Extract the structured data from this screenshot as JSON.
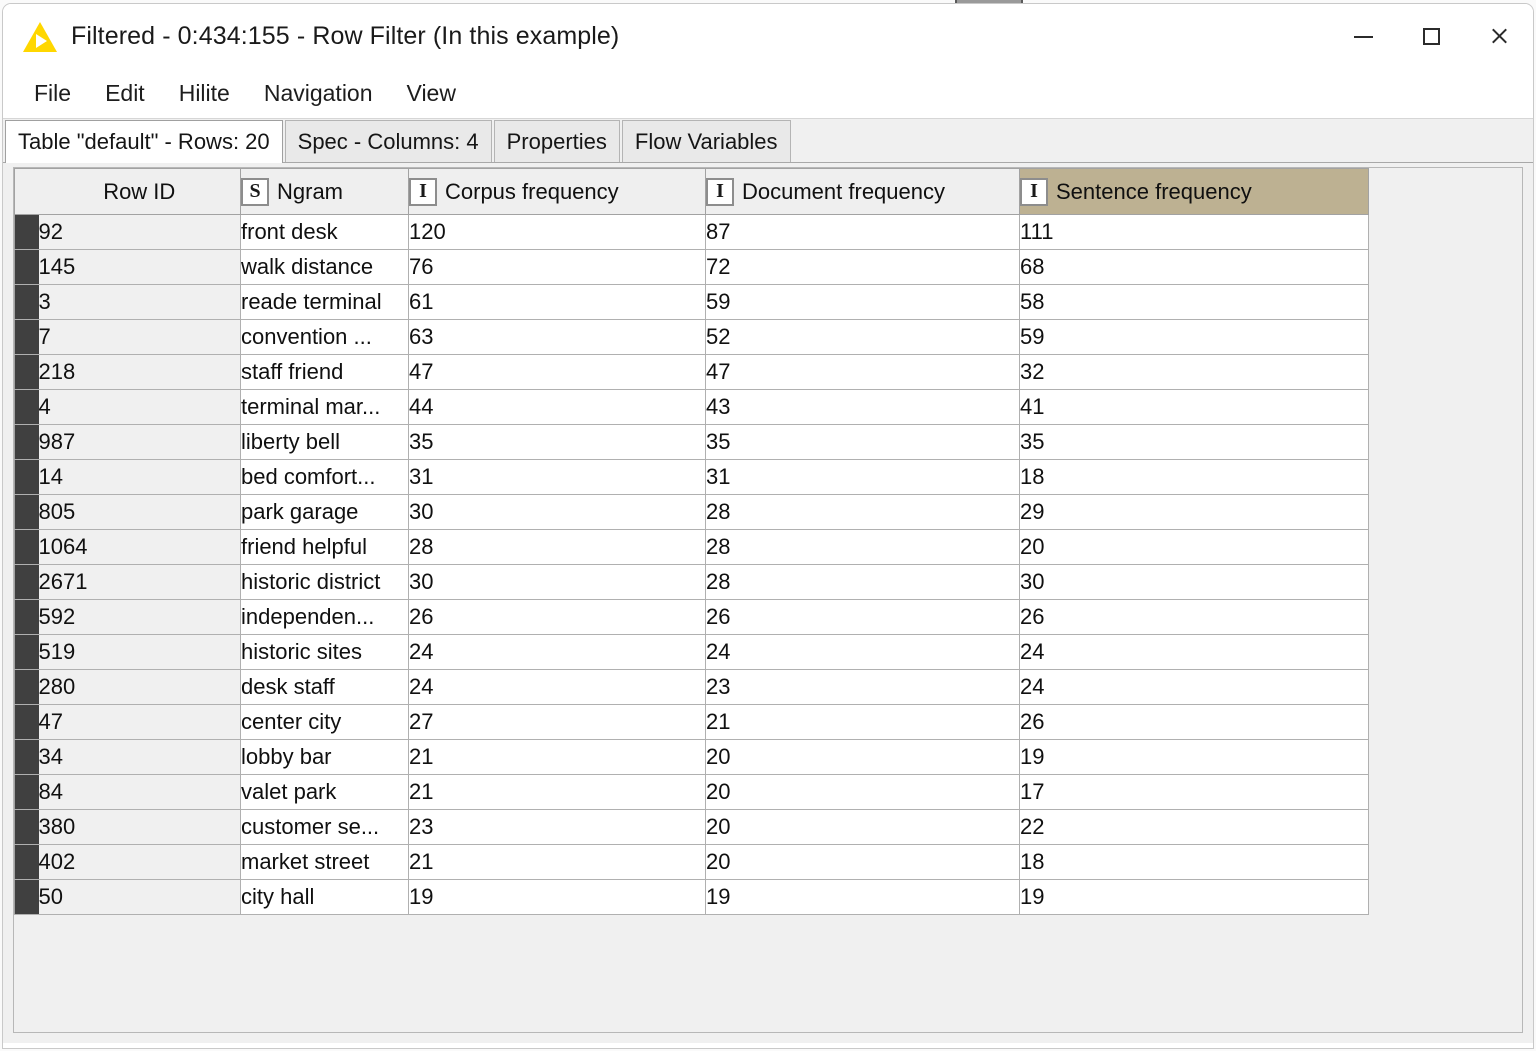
{
  "window": {
    "title": "Filtered - 0:434:155 - Row Filter (In this example)",
    "app_icon": "knime-triangle-icon",
    "controls": {
      "minimize": "minimize-icon",
      "maximize": "maximize-icon",
      "close": "close-icon"
    }
  },
  "menubar": {
    "items": [
      {
        "label": "File"
      },
      {
        "label": "Edit"
      },
      {
        "label": "Hilite"
      },
      {
        "label": "Navigation"
      },
      {
        "label": "View"
      }
    ]
  },
  "tabs": [
    {
      "label": "Table \"default\" - Rows: 20",
      "selected": true
    },
    {
      "label": "Spec - Columns: 4",
      "selected": false
    },
    {
      "label": "Properties",
      "selected": false
    },
    {
      "label": "Flow Variables",
      "selected": false
    }
  ],
  "colors": {
    "selected_column_header": "#bdb192",
    "row_swatch": "#404040",
    "accent_icon": "#ffd700"
  },
  "table": {
    "columns": [
      {
        "id": "rowid",
        "label": "Row ID",
        "type_icon": "",
        "selected": false
      },
      {
        "id": "ngram",
        "label": "Ngram",
        "type_icon": "S",
        "selected": false
      },
      {
        "id": "corpus",
        "label": "Corpus frequency",
        "type_icon": "I",
        "selected": false
      },
      {
        "id": "doc",
        "label": "Document frequency",
        "type_icon": "I",
        "selected": false
      },
      {
        "id": "sent",
        "label": "Sentence frequency",
        "type_icon": "I",
        "selected": true
      }
    ],
    "rows": [
      {
        "rowid": "92",
        "ngram": "front desk",
        "corpus": "120",
        "doc": "87",
        "sent": "111"
      },
      {
        "rowid": "145",
        "ngram": "walk distance",
        "corpus": "76",
        "doc": "72",
        "sent": "68"
      },
      {
        "rowid": "3",
        "ngram": "reade terminal",
        "corpus": "61",
        "doc": "59",
        "sent": "58"
      },
      {
        "rowid": "7",
        "ngram": "convention ...",
        "corpus": "63",
        "doc": "52",
        "sent": "59"
      },
      {
        "rowid": "218",
        "ngram": "staff friend",
        "corpus": "47",
        "doc": "47",
        "sent": "32"
      },
      {
        "rowid": "4",
        "ngram": "terminal mar...",
        "corpus": "44",
        "doc": "43",
        "sent": "41"
      },
      {
        "rowid": "987",
        "ngram": "liberty bell",
        "corpus": "35",
        "doc": "35",
        "sent": "35"
      },
      {
        "rowid": "14",
        "ngram": "bed comfort...",
        "corpus": "31",
        "doc": "31",
        "sent": "18"
      },
      {
        "rowid": "805",
        "ngram": "park garage",
        "corpus": "30",
        "doc": "28",
        "sent": "29"
      },
      {
        "rowid": "1064",
        "ngram": "friend helpful",
        "corpus": "28",
        "doc": "28",
        "sent": "20"
      },
      {
        "rowid": "2671",
        "ngram": "historic district",
        "corpus": "30",
        "doc": "28",
        "sent": "30"
      },
      {
        "rowid": "592",
        "ngram": "independen...",
        "corpus": "26",
        "doc": "26",
        "sent": "26"
      },
      {
        "rowid": "519",
        "ngram": "historic sites",
        "corpus": "24",
        "doc": "24",
        "sent": "24"
      },
      {
        "rowid": "280",
        "ngram": "desk staff",
        "corpus": "24",
        "doc": "23",
        "sent": "24"
      },
      {
        "rowid": "47",
        "ngram": "center city",
        "corpus": "27",
        "doc": "21",
        "sent": "26"
      },
      {
        "rowid": "34",
        "ngram": "lobby bar",
        "corpus": "21",
        "doc": "20",
        "sent": "19"
      },
      {
        "rowid": "84",
        "ngram": "valet park",
        "corpus": "21",
        "doc": "20",
        "sent": "17"
      },
      {
        "rowid": "380",
        "ngram": "customer se...",
        "corpus": "23",
        "doc": "20",
        "sent": "22"
      },
      {
        "rowid": "402",
        "ngram": "market street",
        "corpus": "21",
        "doc": "20",
        "sent": "18"
      },
      {
        "rowid": "50",
        "ngram": "city hall",
        "corpus": "19",
        "doc": "19",
        "sent": "19"
      }
    ]
  }
}
